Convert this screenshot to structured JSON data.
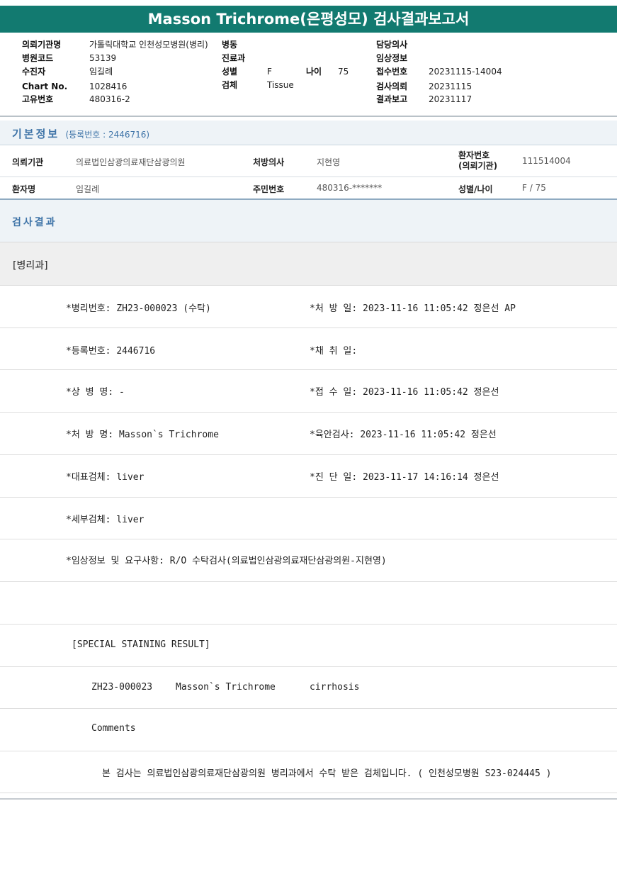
{
  "title": "Masson Trichrome(은평성모) 검사결과보고서",
  "header": {
    "left": [
      {
        "label": "의뢰기관명",
        "value": "가톨릭대학교 인천성모병원(병리)"
      },
      {
        "label": "병원코드",
        "value": "53139"
      },
      {
        "label": "수진자",
        "value": "임길례"
      },
      {
        "label": "Chart No.",
        "value": "1028416"
      },
      {
        "label": "고유번호",
        "value": "480316-2"
      }
    ],
    "mid": [
      {
        "label": "병동",
        "value": ""
      },
      {
        "label": "진료과",
        "value": ""
      },
      {
        "label": "성별",
        "value": "F"
      },
      {
        "label": "검체",
        "value": "Tissue"
      }
    ],
    "age": {
      "label": "나이",
      "value": "75"
    },
    "right": [
      {
        "label": "담당의사",
        "value": ""
      },
      {
        "label": "임상정보",
        "value": ""
      },
      {
        "label": "접수번호",
        "value": "20231115-14004"
      },
      {
        "label": "검사의뢰",
        "value": "20231115"
      },
      {
        "label": "결과보고",
        "value": "20231117"
      }
    ]
  },
  "basic_info": {
    "title": "기본정보",
    "sub": "(등록번호 : 2446716)",
    "row1": {
      "inst_label": "의뢰기관",
      "inst_value": "의료법인삼광의료재단삼광의원",
      "doctor_label": "처방의사",
      "doctor_value": "지현영",
      "pid_label_1": "환자번호",
      "pid_label_2": "(의뢰기관)",
      "pid_value": "111514004"
    },
    "row2": {
      "name_label": "환자명",
      "name_value": "임길례",
      "ssn_label": "주민번호",
      "ssn_value": "480316-*******",
      "sexage_label": "성별/나이",
      "sexage_value": "F / 75"
    }
  },
  "results": {
    "title": "검사결과",
    "dept": "[병리과]",
    "rows": [
      {
        "left": "*병리번호: ZH23-000023 (수탁)",
        "right": "*처 방 일: 2023-11-16 11:05:42  정은선 AP"
      },
      {
        "left": "*등록번호: 2446716",
        "right": "*채 취 일:"
      },
      {
        "left": "*상 병 명: -",
        "right": "*접 수 일: 2023-11-16 11:05:42  정은선"
      },
      {
        "left": "*처 방 명: Masson`s Trichrome",
        "right": "*육안검사: 2023-11-16 11:05:42  정은선"
      },
      {
        "left": "*대표검체: liver",
        "right": "*진 단 일: 2023-11-17 14:16:14  정은선"
      },
      {
        "left": "*세부검체: liver",
        "right": ""
      }
    ],
    "clinical": "*임상정보 및 요구사항: R/O 수탁검사(의료법인삼광의료재단삼광의원-지현영)",
    "special_header": "[SPECIAL STAINING RESULT]",
    "special_no": "ZH23-000023",
    "special_stain": "Masson`s Trichrome",
    "special_result": "cirrhosis",
    "comments_label": "Comments",
    "comment_text": "본 검사는 의료법인삼광의료재단삼광의원 병리과에서 수탁 받은 검체입니다. ( 인천성모병원 S23-024445 )"
  }
}
